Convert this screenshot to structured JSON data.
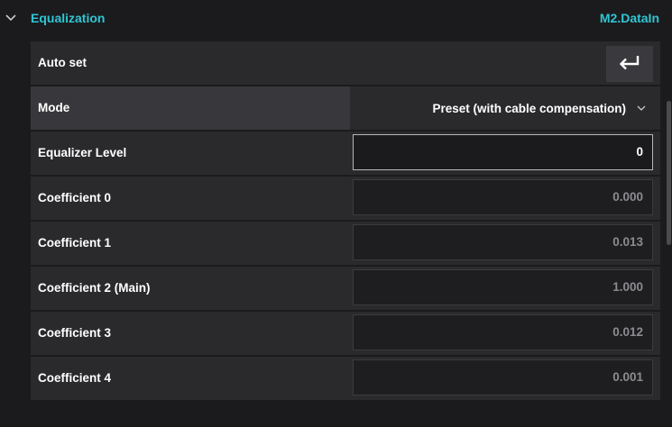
{
  "header": {
    "title": "Equalization",
    "source": "M2.DataIn",
    "accent_color": "#2fc6d3"
  },
  "auto_set": {
    "label": "Auto set",
    "button_icon": "enter-return-icon"
  },
  "mode": {
    "label": "Mode",
    "value": "Preset (with cable compensation)"
  },
  "equalizer_level": {
    "label": "Equalizer Level",
    "value": "0"
  },
  "coefficients": [
    {
      "label": "Coefficient 0",
      "value": "0.000"
    },
    {
      "label": "Coefficient 1",
      "value": "0.013"
    },
    {
      "label": "Coefficient 2 (Main)",
      "value": "1.000"
    },
    {
      "label": "Coefficient 3",
      "value": "0.012"
    },
    {
      "label": "Coefficient 4",
      "value": "0.001"
    }
  ]
}
